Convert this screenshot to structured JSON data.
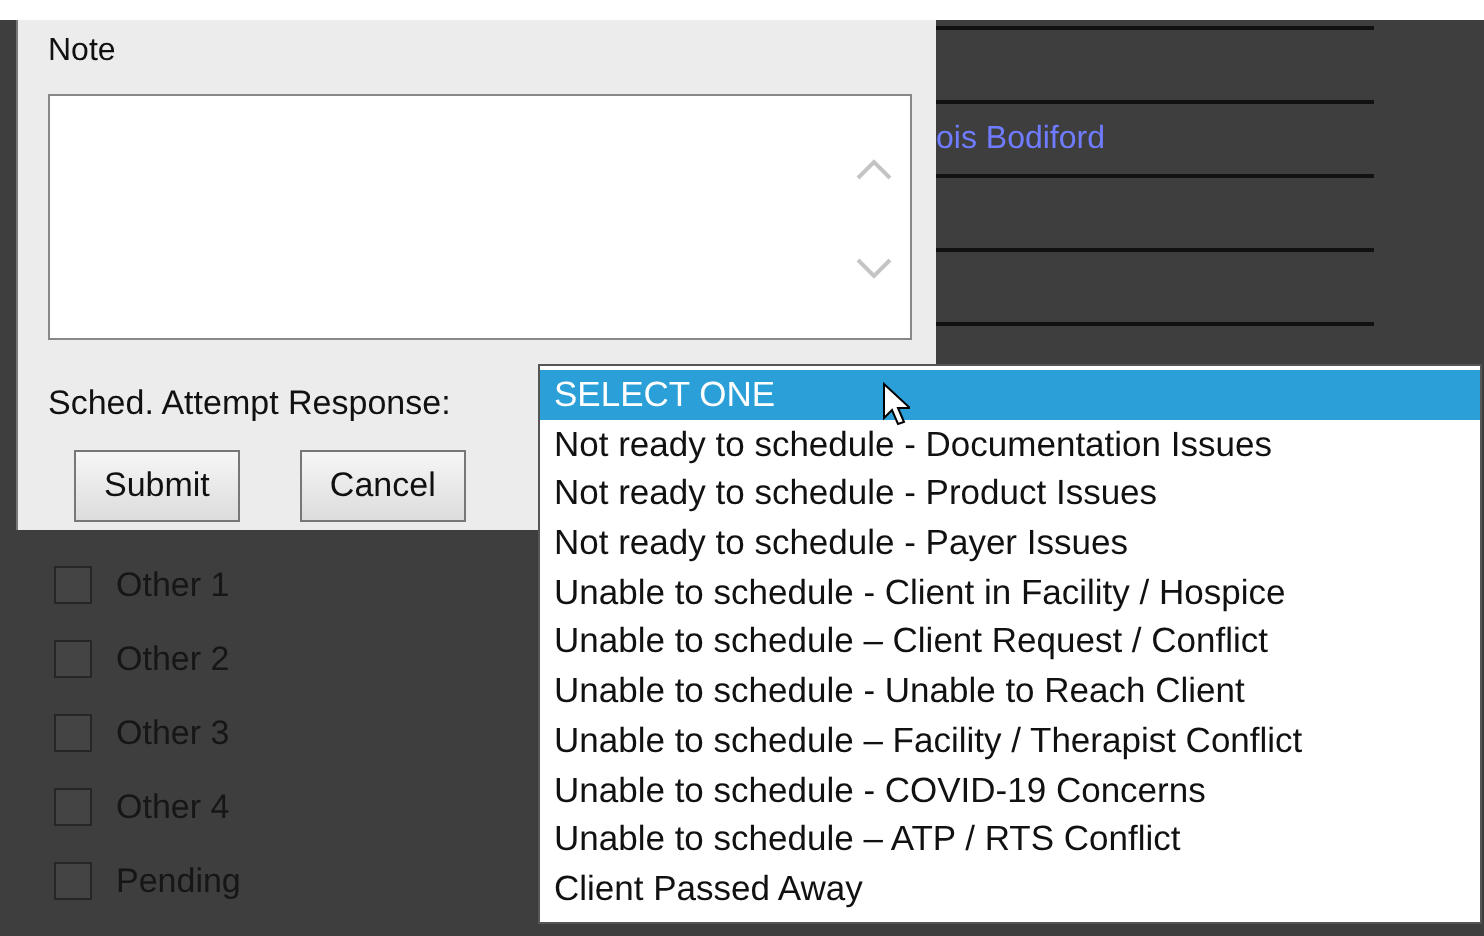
{
  "background": {
    "link": "ois Bodiford",
    "checkboxes": [
      {
        "label": "Other 1",
        "checked": false
      },
      {
        "label": "Other 2",
        "checked": false
      },
      {
        "label": "Other 3",
        "checked": false
      },
      {
        "label": "Other 4",
        "checked": false
      },
      {
        "label": "Pending",
        "checked": false
      }
    ]
  },
  "dialog": {
    "note_label": "Note",
    "response_label": "Sched. Attempt Response:",
    "buttons": [
      "Submit",
      "Cancel"
    ]
  },
  "dropdown": {
    "options": [
      {
        "label": "SELECT ONE",
        "selected": true
      },
      {
        "label": "Not ready to schedule - Documentation Issues",
        "selected": false
      },
      {
        "label": "Not ready to schedule - Product Issues",
        "selected": false
      },
      {
        "label": "Not ready to schedule - Payer Issues",
        "selected": false
      },
      {
        "label": "Unable to schedule - Client in Facility / Hospice",
        "selected": false
      },
      {
        "label": "Unable to schedule – Client Request / Conflict",
        "selected": false
      },
      {
        "label": "Unable to schedule - Unable to Reach Client",
        "selected": false
      },
      {
        "label": "Unable to schedule – Facility / Therapist Conflict",
        "selected": false
      },
      {
        "label": "Unable to schedule - COVID-19 Concerns",
        "selected": false
      },
      {
        "label": "Unable to schedule – ATP / RTS Conflict",
        "selected": false
      },
      {
        "label": "Client Passed Away",
        "selected": false
      }
    ]
  }
}
